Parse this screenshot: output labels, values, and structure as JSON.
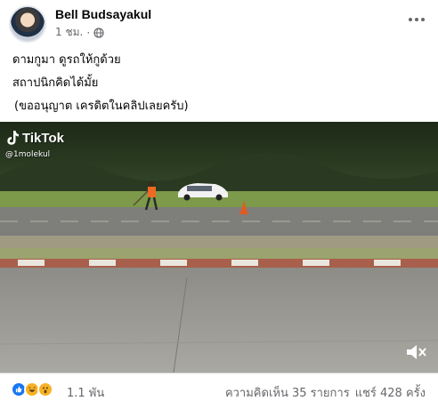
{
  "post": {
    "author": "Bell Budsayakul",
    "time": "1 ชม.",
    "separator": "·",
    "privacy_icon": "globe-icon",
    "more_icon": "more-options-icon"
  },
  "caption": {
    "line1": "ดามกูมา ดูรถให้กูด้วย",
    "line2": "สถาปนิกคิดได้มั้ย",
    "line3": "(ขออนุญาต เครดิตในคลิปเลยครับ)"
  },
  "video": {
    "watermark_brand": "TikTok",
    "watermark_handle": "@1molekul",
    "mute_icon": "speaker-muted-icon"
  },
  "footer": {
    "reaction_icons": [
      "like-icon",
      "haha-icon",
      "wow-icon"
    ],
    "reaction_count": "1.1 พัน",
    "comments": "ความคิดเห็น 35 รายการ",
    "shares": "แชร์ 428 ครั้ง"
  },
  "colors": {
    "text_primary": "#050505",
    "text_secondary": "#65676b",
    "like_blue": "#1877f2",
    "emoji_yellow": "#f7b125"
  }
}
